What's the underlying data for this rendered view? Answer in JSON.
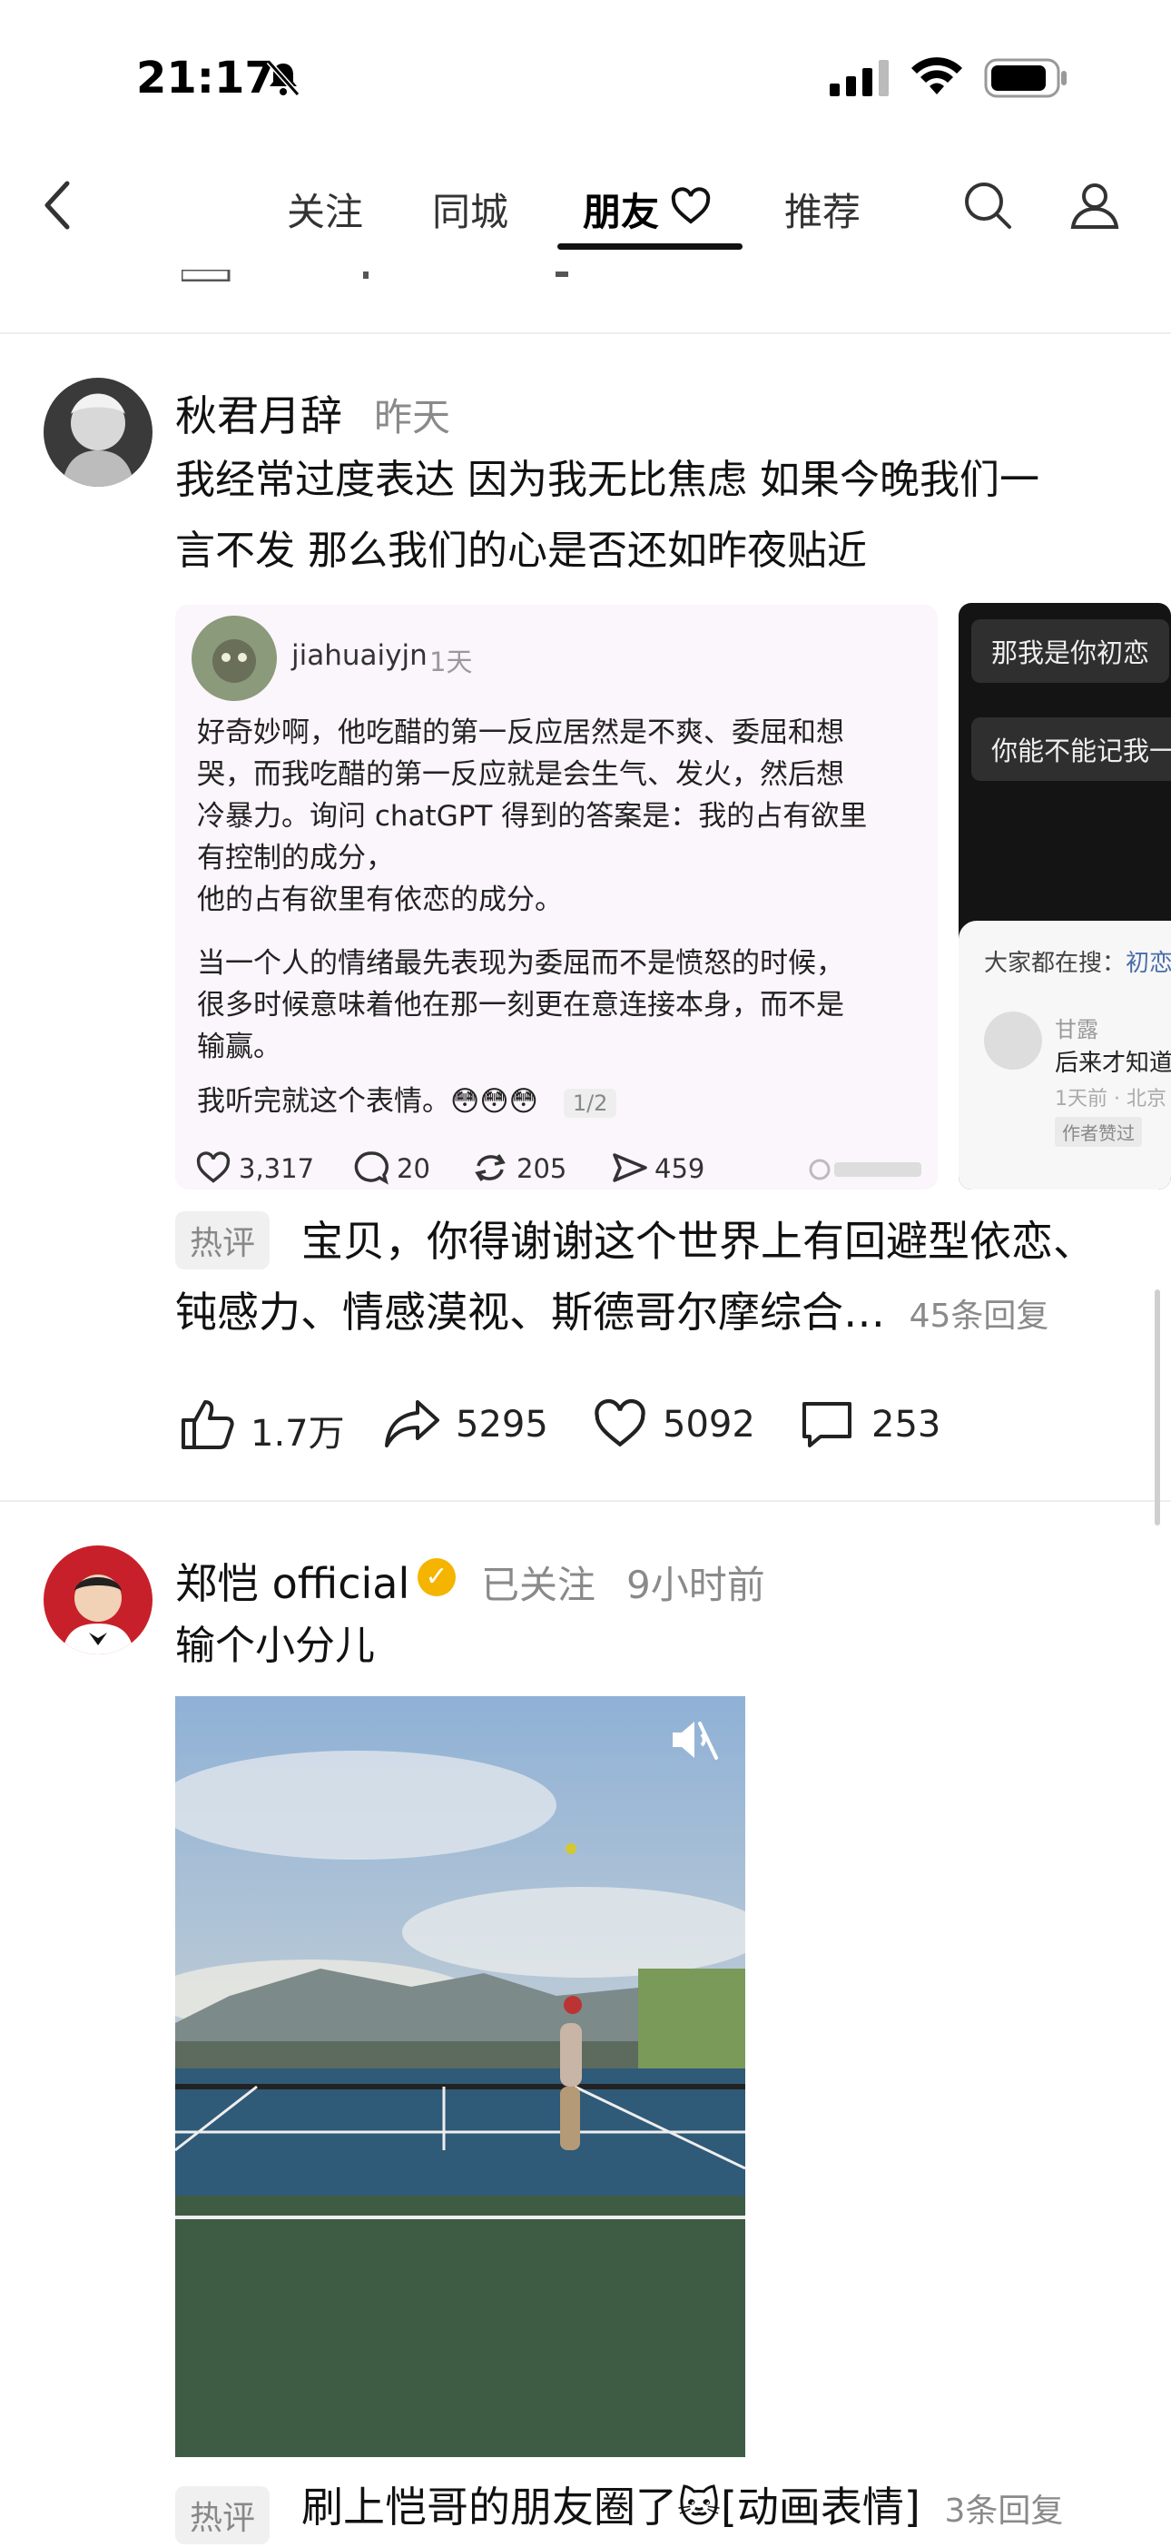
{
  "status_bar": {
    "time": "21:17"
  },
  "nav": {
    "tabs": [
      {
        "label": "关注"
      },
      {
        "label": "同城"
      },
      {
        "label": "朋友"
      },
      {
        "label": "推荐"
      }
    ],
    "active_tab": "朋友"
  },
  "post1": {
    "author": "秋君月辞",
    "time": "昨天",
    "text_line1": "我经常过度表达 因为我无比焦虑 如果今晚我们一",
    "text_line2": "言不发 那么我们的心是否还如昨夜贴近",
    "embedded": {
      "username": "jiahuaiyjn",
      "date": "1天",
      "lines": [
        "好奇妙啊，他吃醋的第一反应居然是不爽、委屈和想",
        "哭，而我吃醋的第一反应就是会生气、发火，然后想",
        "冷暴力。询问 chatGPT 得到的答案是：我的占有欲里",
        "有控制的成分，",
        "他的占有欲里有依恋的成分。",
        "当一个人的情绪最先表现为委屈而不是愤怒的时候，",
        "很多时候意味着他在那一刻更在意连接本身，而不是",
        "输赢。",
        "我听完就这个表情。😳😳😳"
      ],
      "page_indicator": "1/2",
      "likes": "3,317",
      "comments": "20",
      "reposts": "205",
      "shares": "459"
    },
    "embedded2": {
      "bubble1": "那我是你初恋",
      "bubble2": "你能不能记我一",
      "search_label": "大家都在搜：",
      "search_term": "初恋",
      "commenter": "甘露",
      "comment_text": "后来才知道",
      "comment_meta": "1天前 · 北京",
      "author_liked": "作者赞过"
    },
    "hot_tag": "热评",
    "hot_line1": "宝贝，你得谢谢这个世界上有回避型依恋、",
    "hot_line2": "钝感力、情感漠视、斯德哥尔摩综合…",
    "hot_replies": "45条回复",
    "actions": {
      "likes": "1.7万",
      "shares": "5295",
      "hearts": "5092",
      "comments": "253"
    }
  },
  "post2": {
    "author": "郑恺 official",
    "follow_status": "已关注",
    "time": "9小时前",
    "text": "输个小分儿",
    "hot_tag": "热评",
    "hot_text": "刷上恺哥的朋友圈了🐱[动画表情]",
    "hot_replies": "3条回复"
  },
  "icons": [
    "back-icon",
    "heart-icon",
    "search-icon",
    "profile-icon",
    "mute-icon",
    "thumb-up-icon",
    "share-icon",
    "comment-icon",
    "verified-icon"
  ],
  "colors": {
    "verified": "#f4b400",
    "muted_text": "#8a8a8a"
  }
}
